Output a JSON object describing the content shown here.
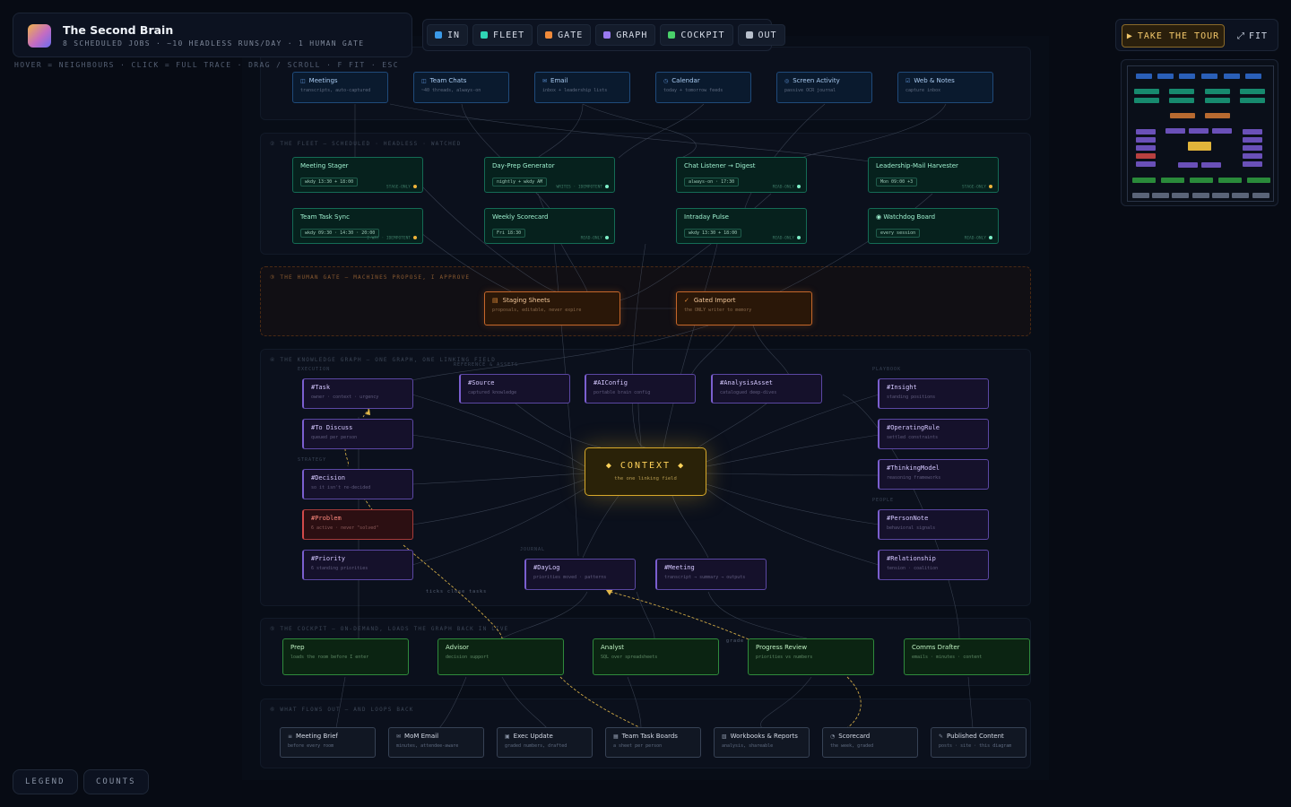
{
  "header": {
    "title": "The Second Brain",
    "subtitle": "8 SCHEDULED JOBS · ~10 HEADLESS RUNS/DAY · 1 HUMAN GATE",
    "hint": "HOVER = NEIGHBOURS · CLICK = FULL TRACE · DRAG / SCROLL · F FIT · ESC"
  },
  "filters": [
    {
      "label": "IN",
      "color": "#3b9ae8"
    },
    {
      "label": "FLEET",
      "color": "#2fd4b4"
    },
    {
      "label": "GATE",
      "color": "#f08a3a"
    },
    {
      "label": "GRAPH",
      "color": "#9a7af0"
    },
    {
      "label": "COCKPIT",
      "color": "#4ad06a"
    },
    {
      "label": "OUT",
      "color": "#b8c0cc"
    }
  ],
  "controls": {
    "tour": "TAKE THE TOUR",
    "tour_icon": "▶",
    "fit": "FIT",
    "fit_icon": "⤢"
  },
  "bottom": {
    "legend": "LEGEND",
    "counts": "COUNTS"
  },
  "bands": {
    "fleet": "② THE FLEET — SCHEDULED · HEADLESS · WATCHED",
    "gate": "③ THE HUMAN GATE — MACHINES PROPOSE, I APPROVE",
    "graph": "④ THE KNOWLEDGE GRAPH — ONE GRAPH, ONE LINKING FIELD",
    "cockpit": "⑤ THE COCKPIT — ON-DEMAND, LOADS THE GRAPH BACK IN LIVE",
    "out": "⑥ WHAT FLOWS OUT — AND LOOPS BACK"
  },
  "sublabels": {
    "execution": "EXECUTION",
    "reference": "REFERENCE & ASSETS",
    "playbook": "PLAYBOOK",
    "strategy": "STRATEGY",
    "people": "PEOPLE",
    "journal": "JOURNAL",
    "ticks": "ticks close tasks",
    "grade": "grade"
  },
  "inputs": [
    {
      "icon": "◫",
      "title": "Meetings",
      "sub": "transcripts, auto-captured"
    },
    {
      "icon": "◫",
      "title": "Team Chats",
      "sub": "~40 threads, always-on"
    },
    {
      "icon": "✉",
      "title": "Email",
      "sub": "inbox + leadership lists"
    },
    {
      "icon": "◷",
      "title": "Calendar",
      "sub": "today + tomorrow feeds"
    },
    {
      "icon": "◎",
      "title": "Screen Activity",
      "sub": "passive OCR journal"
    },
    {
      "icon": "☑",
      "title": "Web & Notes",
      "sub": "capture inbox"
    }
  ],
  "fleet": [
    {
      "title": "Meeting Stager",
      "chip": "wkdy 13:30 + 18:00",
      "tag": "STAGE-ONLY",
      "dot": "#f0b43a"
    },
    {
      "title": "Day-Prep Generator",
      "chip": "nightly + wkdy AM",
      "tag": "WRITES · IDEMPOTENT",
      "dot": "#7ef0c8"
    },
    {
      "title": "Chat Listener → Digest",
      "chip": "always-on · 17:30",
      "tag": "READ-ONLY",
      "dot": "#7ef0c8"
    },
    {
      "title": "Leadership-Mail Harvester",
      "chip": "Mon 09:00 +3",
      "tag": "STAGE-ONLY",
      "dot": "#f0b43a"
    },
    {
      "title": "Team Task Sync",
      "chip": "wkdy 09:30 · 14:30 · 20:00",
      "tag": "2-WAY · IDEMPOTENT",
      "dot": "#f0b43a"
    },
    {
      "title": "Weekly Scorecard",
      "chip": "Fri 18:30",
      "tag": "READ-ONLY",
      "dot": "#7ef0c8"
    },
    {
      "title": "Intraday Pulse",
      "chip": "wkdy 13:30 + 18:00",
      "tag": "READ-ONLY",
      "dot": "#7ef0c8"
    },
    {
      "title": "◉  Watchdog Board",
      "chip": "every session",
      "tag": "READ-ONLY",
      "dot": "#7ef0c8"
    }
  ],
  "gate": [
    {
      "icon": "▤",
      "title": "Staging Sheets",
      "sub": "proposals, editable, never expire"
    },
    {
      "icon": "✓",
      "title": "Gated Import",
      "sub": "the ONLY writer to memory"
    }
  ],
  "graph": {
    "context": {
      "title": "◆  CONTEXT  ◆",
      "sub": "the one linking field"
    },
    "nodes": [
      {
        "title": "#Task",
        "sub": "owner · context · urgency"
      },
      {
        "title": "#To Discuss",
        "sub": "queued per person"
      },
      {
        "title": "#Decision",
        "sub": "so it isn't re-decided"
      },
      {
        "title": "#Problem",
        "sub": "6 active · never \"solved\""
      },
      {
        "title": "#Priority",
        "sub": "6 standing priorities"
      },
      {
        "title": "#Source",
        "sub": "captured knowledge"
      },
      {
        "title": "#AIConfig",
        "sub": "portable brain config"
      },
      {
        "title": "#AnalysisAsset",
        "sub": "catalogued deep-dives"
      },
      {
        "title": "#Insight",
        "sub": "standing positions"
      },
      {
        "title": "#OperatingRule",
        "sub": "settled constraints"
      },
      {
        "title": "#ThinkingModel",
        "sub": "reasoning frameworks"
      },
      {
        "title": "#PersonNote",
        "sub": "behavioral signals"
      },
      {
        "title": "#Relationship",
        "sub": "tension · coalition"
      },
      {
        "title": "#DayLog",
        "sub": "priorities moved · patterns"
      },
      {
        "title": "#Meeting",
        "sub": "transcript → summary → outputs"
      }
    ]
  },
  "cockpit": [
    {
      "title": "Prep",
      "sub": "loads the room before I enter"
    },
    {
      "title": "Advisor",
      "sub": "decision support"
    },
    {
      "title": "Analyst",
      "sub": "SQL over spreadsheets"
    },
    {
      "title": "Progress Review",
      "sub": "priorities vs numbers"
    },
    {
      "title": "Comms Drafter",
      "sub": "emails · minutes · content"
    }
  ],
  "out": [
    {
      "icon": "≡",
      "title": "Meeting Brief",
      "sub": "before every room"
    },
    {
      "icon": "✉",
      "title": "MoM Email",
      "sub": "minutes, attendee-aware"
    },
    {
      "icon": "▣",
      "title": "Exec Update",
      "sub": "graded numbers, drafted"
    },
    {
      "icon": "▦",
      "title": "Team Task Boards",
      "sub": "a sheet per person"
    },
    {
      "icon": "▧",
      "title": "Workbooks & Reports",
      "sub": "analysis, shareable"
    },
    {
      "icon": "◔",
      "title": "Scorecard",
      "sub": "the week, graded"
    },
    {
      "icon": "✎",
      "title": "Published Content",
      "sub": "posts · site · this diagram"
    }
  ]
}
